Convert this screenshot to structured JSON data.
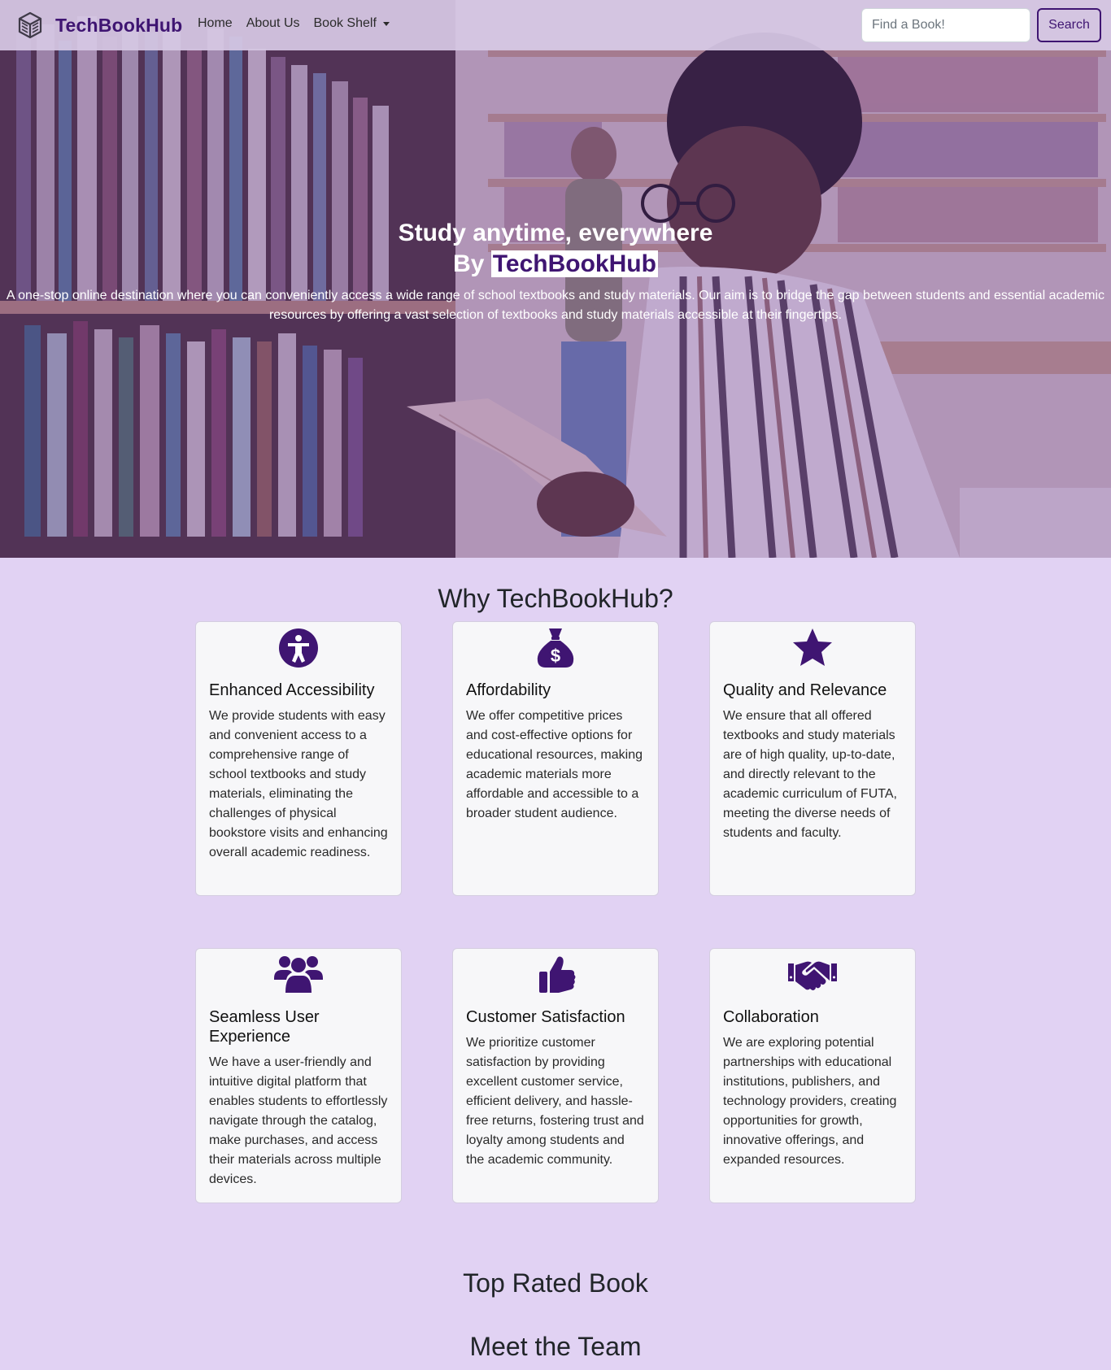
{
  "navbar": {
    "brand": "TechBookHub",
    "links": [
      {
        "label": "Home"
      },
      {
        "label": "About Us"
      },
      {
        "label": "Book Shelf"
      }
    ],
    "search_placeholder": "Find a Book!",
    "search_button": "Search"
  },
  "hero": {
    "title_line1": "Study anytime, everywhere",
    "title_prefix": "By",
    "title_highlight": "TechBookHub",
    "description": "A one-stop online destination where you can conveniently access a wide range of school textbooks and study materials. Our aim is to bridge the gap between students and essential academic resources by offering a vast selection of textbooks and study materials accessible at their fingertips."
  },
  "why": {
    "heading": "Why TechBookHub?",
    "cards": [
      {
        "icon": "accessibility-icon",
        "title": "Enhanced Accessibility",
        "text": "We provide students with easy and convenient access to a comprehensive range of school textbooks and study materials, eliminating the challenges of physical bookstore visits and enhancing overall academic readiness."
      },
      {
        "icon": "money-bag-icon",
        "title": "Affordability",
        "text": "We offer competitive prices and cost-effective options for educational resources, making academic materials more affordable and accessible to a broader student audience."
      },
      {
        "icon": "star-icon",
        "title": "Quality and Relevance",
        "text": "We ensure that all offered textbooks and study materials are of high quality, up-to-date, and directly relevant to the academic curriculum of FUTA, meeting the diverse needs of students and faculty."
      },
      {
        "icon": "users-icon",
        "title": "Seamless User Experience",
        "text": "We have a user-friendly and intuitive digital platform that enables students to effortlessly navigate through the catalog, make purchases, and access their materials across multiple devices."
      },
      {
        "icon": "thumbs-up-icon",
        "title": "Customer Satisfaction",
        "text": "We prioritize customer satisfaction by providing excellent customer service, efficient delivery, and hassle-free returns, fostering trust and loyalty among students and the academic community."
      },
      {
        "icon": "handshake-icon",
        "title": "Collaboration",
        "text": "We are exploring potential partnerships with educational institutions, publishers, and technology providers, creating opportunities for growth, innovative offerings, and expanded resources."
      }
    ]
  },
  "top_rated": {
    "heading": "Top Rated Book"
  },
  "team": {
    "heading": "Meet the Team"
  },
  "colors": {
    "brand": "#3f1572",
    "page_background": "#e1d2f3",
    "card_background": "#f7f7f9"
  }
}
